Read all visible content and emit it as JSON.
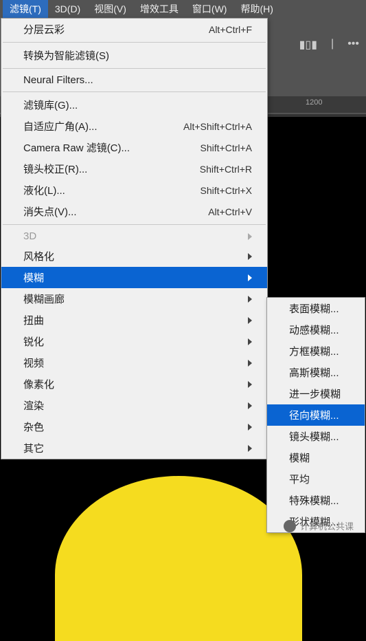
{
  "menubar": {
    "items": [
      "滤镜(T)",
      "3D(D)",
      "视图(V)",
      "增效工具",
      "窗口(W)",
      "帮助(H)"
    ],
    "active_index": 0
  },
  "ruler": {
    "tick": "1200"
  },
  "dropdown": {
    "groups": [
      [
        {
          "label": "分层云彩",
          "shortcut": "Alt+Ctrl+F"
        }
      ],
      [
        {
          "label": "转换为智能滤镜(S)"
        }
      ],
      [
        {
          "label": "Neural Filters..."
        }
      ],
      [
        {
          "label": "滤镜库(G)..."
        },
        {
          "label": "自适应广角(A)...",
          "shortcut": "Alt+Shift+Ctrl+A"
        },
        {
          "label": "Camera Raw 滤镜(C)...",
          "shortcut": "Shift+Ctrl+A"
        },
        {
          "label": "镜头校正(R)...",
          "shortcut": "Shift+Ctrl+R"
        },
        {
          "label": "液化(L)...",
          "shortcut": "Shift+Ctrl+X"
        },
        {
          "label": "消失点(V)...",
          "shortcut": "Alt+Ctrl+V"
        }
      ],
      [
        {
          "label": "3D",
          "submenu": true,
          "disabled": true
        },
        {
          "label": "风格化",
          "submenu": true
        },
        {
          "label": "模糊",
          "submenu": true,
          "highlight": true
        },
        {
          "label": "模糊画廊",
          "submenu": true
        },
        {
          "label": "扭曲",
          "submenu": true
        },
        {
          "label": "锐化",
          "submenu": true
        },
        {
          "label": "视频",
          "submenu": true
        },
        {
          "label": "像素化",
          "submenu": true
        },
        {
          "label": "渲染",
          "submenu": true
        },
        {
          "label": "杂色",
          "submenu": true
        },
        {
          "label": "其它",
          "submenu": true
        }
      ]
    ]
  },
  "submenu": {
    "items": [
      {
        "label": "表面模糊..."
      },
      {
        "label": "动感模糊..."
      },
      {
        "label": "方框模糊..."
      },
      {
        "label": "高斯模糊..."
      },
      {
        "label": "进一步模糊"
      },
      {
        "label": "径向模糊...",
        "highlight": true
      },
      {
        "label": "镜头模糊..."
      },
      {
        "label": "模糊"
      },
      {
        "label": "平均"
      },
      {
        "label": "特殊模糊..."
      },
      {
        "label": "形状模糊..."
      }
    ]
  },
  "watermark": {
    "text": "计算机公共课"
  }
}
